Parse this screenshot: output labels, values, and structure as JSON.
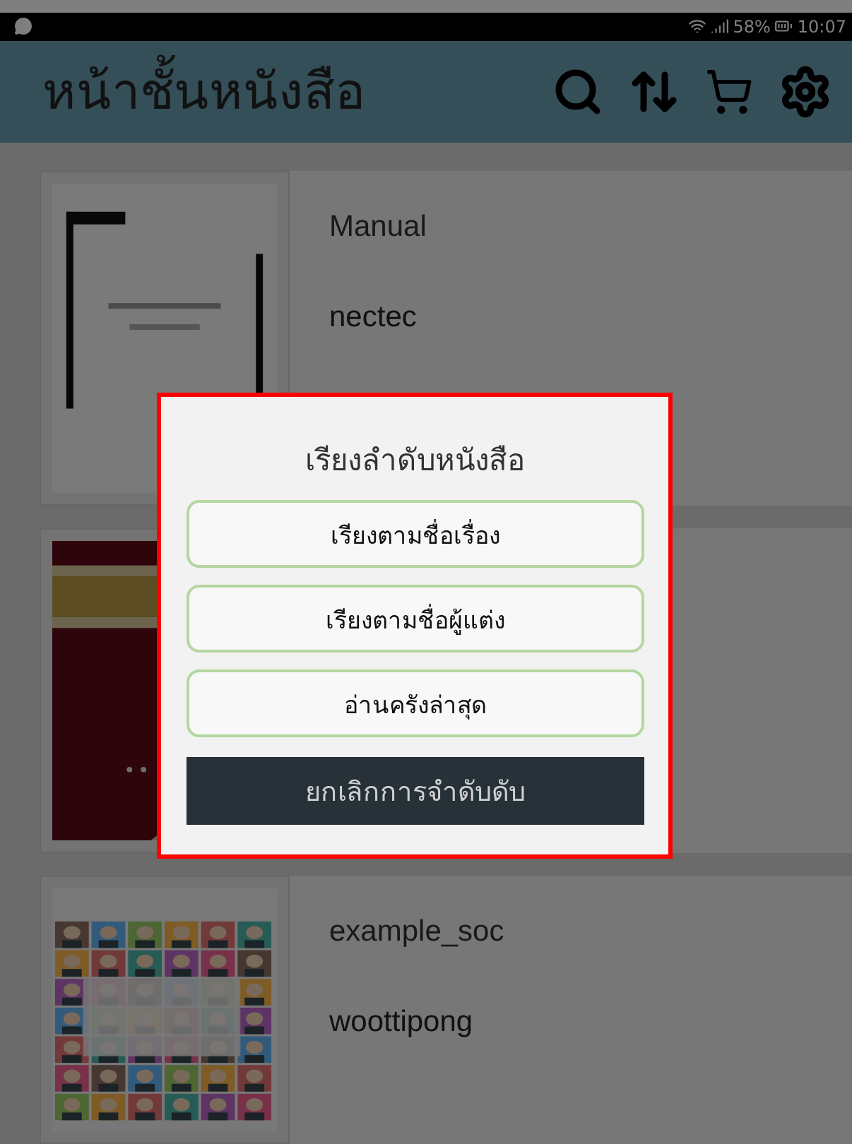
{
  "status_bar": {
    "battery": "58%",
    "time": "10:07"
  },
  "app_bar": {
    "title": "หน้าชั้นหนังสือ"
  },
  "books": [
    {
      "cover": {
        "kind": "picture"
      },
      "title": "Manual",
      "author": "nectec"
    },
    {
      "cover": {
        "kind": "picture"
      }
    },
    {
      "cover": {
        "kind": "picture"
      },
      "title": "example_soc",
      "author": "woottipong"
    }
  ],
  "sort_dialog": {
    "title": "เรียงลำดับหนังสือ",
    "options": [
      "เรียงตามชื่อเรื่อง",
      "เรียงตามชื่อผู้แต่ง",
      "อ่านครังล่าสุด"
    ],
    "cancel": "ยกเลิกการจำดับดับ"
  }
}
